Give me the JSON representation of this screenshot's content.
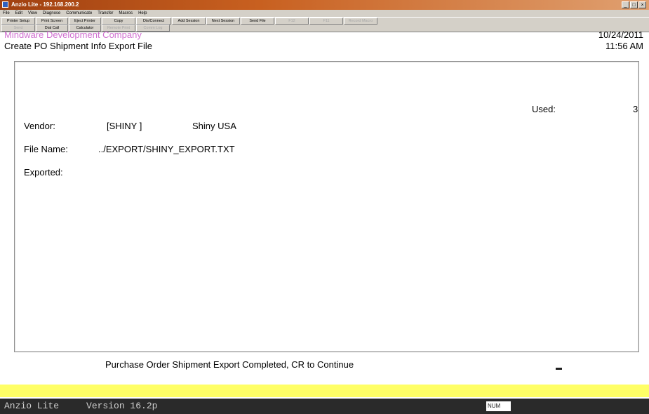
{
  "window": {
    "title": "Anzio Lite - 192.168.200.2"
  },
  "menu": [
    "File",
    "Edit",
    "View",
    "Diagnose",
    "Communicate",
    "Transfer",
    "Macros",
    "Help"
  ],
  "toolbar_row1": [
    {
      "label": "Printer Setup",
      "enabled": true
    },
    {
      "label": "Print Screen",
      "enabled": true
    },
    {
      "label": "Eject Printer",
      "enabled": true
    },
    {
      "label": "Copy",
      "enabled": true
    },
    {
      "label": "Dis/Connect",
      "enabled": true
    },
    {
      "label": "Add Session",
      "enabled": true
    },
    {
      "label": "Next Session",
      "enabled": true
    },
    {
      "label": "Send File",
      "enabled": true
    },
    {
      "label": "F12",
      "enabled": false
    },
    {
      "label": "F11",
      "enabled": false
    },
    {
      "label": "Record Macro",
      "enabled": false
    }
  ],
  "toolbar_row2": [
    {
      "label": "Send",
      "enabled": false
    },
    {
      "label": "Dial Call",
      "enabled": true
    },
    {
      "label": "Calculator",
      "enabled": true
    },
    {
      "label": "Remote Print",
      "enabled": false
    },
    {
      "label": "Comm Log",
      "enabled": false
    }
  ],
  "screen": {
    "company": "Mindware Development Company",
    "title": "Create PO Shipment Info Export File",
    "date": "10/24/2011",
    "time": "11:56 AM",
    "used_label": "Used:",
    "used_value": "3",
    "vendor_label": "Vendor:",
    "vendor_code": "[SHINY ]",
    "vendor_name": "Shiny USA",
    "file_label": "File Name:",
    "file_value": "../EXPORT/SHINY_EXPORT.TXT",
    "exported_label": "Exported:",
    "status_message": "Purchase Order Shipment Export Completed, CR to Continue"
  },
  "statusbar": {
    "left": "Anzio Lite     Version 16.2p",
    "num": "NUM"
  }
}
